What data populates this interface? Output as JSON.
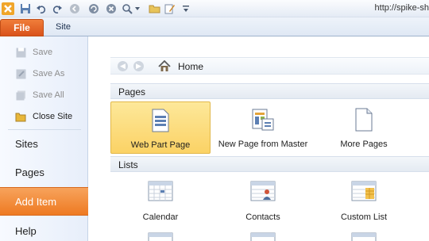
{
  "quick_access": {
    "url": "http://spike-sh",
    "icons": [
      "app-logo-icon",
      "save-icon",
      "undo-icon",
      "redo-icon",
      "back-icon",
      "refresh-icon",
      "stop-icon",
      "preview-icon",
      "dropdown-icon",
      "folder-open-icon",
      "edit-icon",
      "customize-icon"
    ]
  },
  "ribbon": {
    "file_tab": "File",
    "site_tab": "Site"
  },
  "nav": {
    "commands": [
      {
        "label": "Save",
        "icon": "save-icon",
        "enabled": false
      },
      {
        "label": "Save As",
        "icon": "save-as-icon",
        "enabled": false
      },
      {
        "label": "Save All",
        "icon": "save-all-icon",
        "enabled": false
      },
      {
        "label": "Close Site",
        "icon": "close-site-folder-icon",
        "enabled": true
      }
    ],
    "tabs": [
      {
        "label": "Sites",
        "active": false
      },
      {
        "label": "Pages",
        "active": false
      },
      {
        "label": "Add Item",
        "active": true
      },
      {
        "label": "Help",
        "active": false
      }
    ]
  },
  "main": {
    "breadcrumb": {
      "home_label": "Home"
    },
    "pages_section": "Pages",
    "pages": [
      {
        "label": "Web Part Page",
        "icon": "web-part-page-icon",
        "selected": true
      },
      {
        "label": "New Page from Master",
        "icon": "new-page-from-master-icon",
        "selected": false
      },
      {
        "label": "More Pages",
        "icon": "more-pages-icon",
        "selected": false
      }
    ],
    "lists_section": "Lists",
    "lists": [
      {
        "label": "Calendar",
        "icon": "calendar-list-icon"
      },
      {
        "label": "Contacts",
        "icon": "contacts-list-icon"
      },
      {
        "label": "Custom List",
        "icon": "custom-list-icon"
      }
    ]
  },
  "colors": {
    "file_tab": "#e0621e",
    "active_nav": "#ee7d27",
    "selected_tile": "#fbd265",
    "ribbon_bg": "#dfe8f4"
  }
}
